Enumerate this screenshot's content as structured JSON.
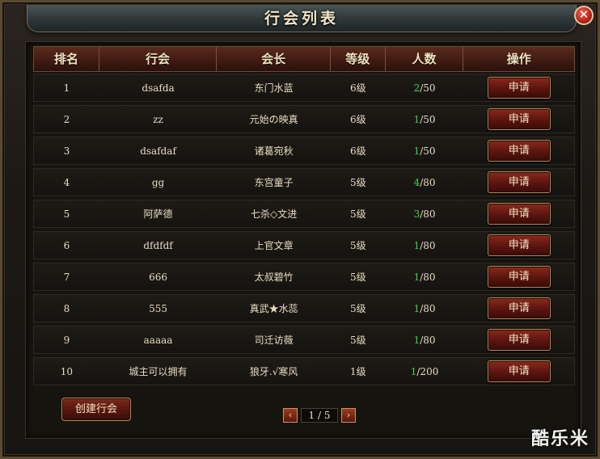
{
  "window": {
    "title": "行会列表",
    "close_label": "✕"
  },
  "table": {
    "headers": {
      "rank": "排名",
      "guild": "行会",
      "leader": "会长",
      "level": "等级",
      "members": "人数",
      "op": "操作"
    },
    "rows": [
      {
        "rank": "1",
        "guild": "dsafda",
        "leader": "东门水蓝",
        "level": "6级",
        "members_cur": "2",
        "members_max": "/50",
        "action": "申请"
      },
      {
        "rank": "2",
        "guild": "zz",
        "leader": "元始の映真",
        "level": "6级",
        "members_cur": "1",
        "members_max": "/50",
        "action": "申请"
      },
      {
        "rank": "3",
        "guild": "dsafdaf",
        "leader": "诸葛宛秋",
        "level": "6级",
        "members_cur": "1",
        "members_max": "/50",
        "action": "申请"
      },
      {
        "rank": "4",
        "guild": "gg",
        "leader": "东宫童子",
        "level": "5级",
        "members_cur": "4",
        "members_max": "/80",
        "action": "申请"
      },
      {
        "rank": "5",
        "guild": "阿萨德",
        "leader": "七杀◇文进",
        "level": "5级",
        "members_cur": "3",
        "members_max": "/80",
        "action": "申请"
      },
      {
        "rank": "6",
        "guild": "dfdfdf",
        "leader": "上官文章",
        "level": "5级",
        "members_cur": "1",
        "members_max": "/80",
        "action": "申请"
      },
      {
        "rank": "7",
        "guild": "666",
        "leader": "太叔碧竹",
        "level": "5级",
        "members_cur": "1",
        "members_max": "/80",
        "action": "申请"
      },
      {
        "rank": "8",
        "guild": "555",
        "leader": "真武★水蕊",
        "level": "5级",
        "members_cur": "1",
        "members_max": "/80",
        "action": "申请"
      },
      {
        "rank": "9",
        "guild": "aaaaa",
        "leader": "司迁访薇",
        "level": "5级",
        "members_cur": "1",
        "members_max": "/80",
        "action": "申请"
      },
      {
        "rank": "10",
        "guild": "城主可以拥有",
        "leader": "狼牙.√寒风",
        "level": "1级",
        "members_cur": "1",
        "members_max": "/200",
        "action": "申请"
      }
    ]
  },
  "footer": {
    "create_label": "创建行会",
    "page_text": "1 / 5",
    "prev_icon": "‹",
    "next_icon": "›"
  },
  "watermark": "酷乐米",
  "colors": {
    "accent_green": "#3fd14a",
    "button_red": "#5e1610",
    "header_red": "#3e1a12"
  }
}
